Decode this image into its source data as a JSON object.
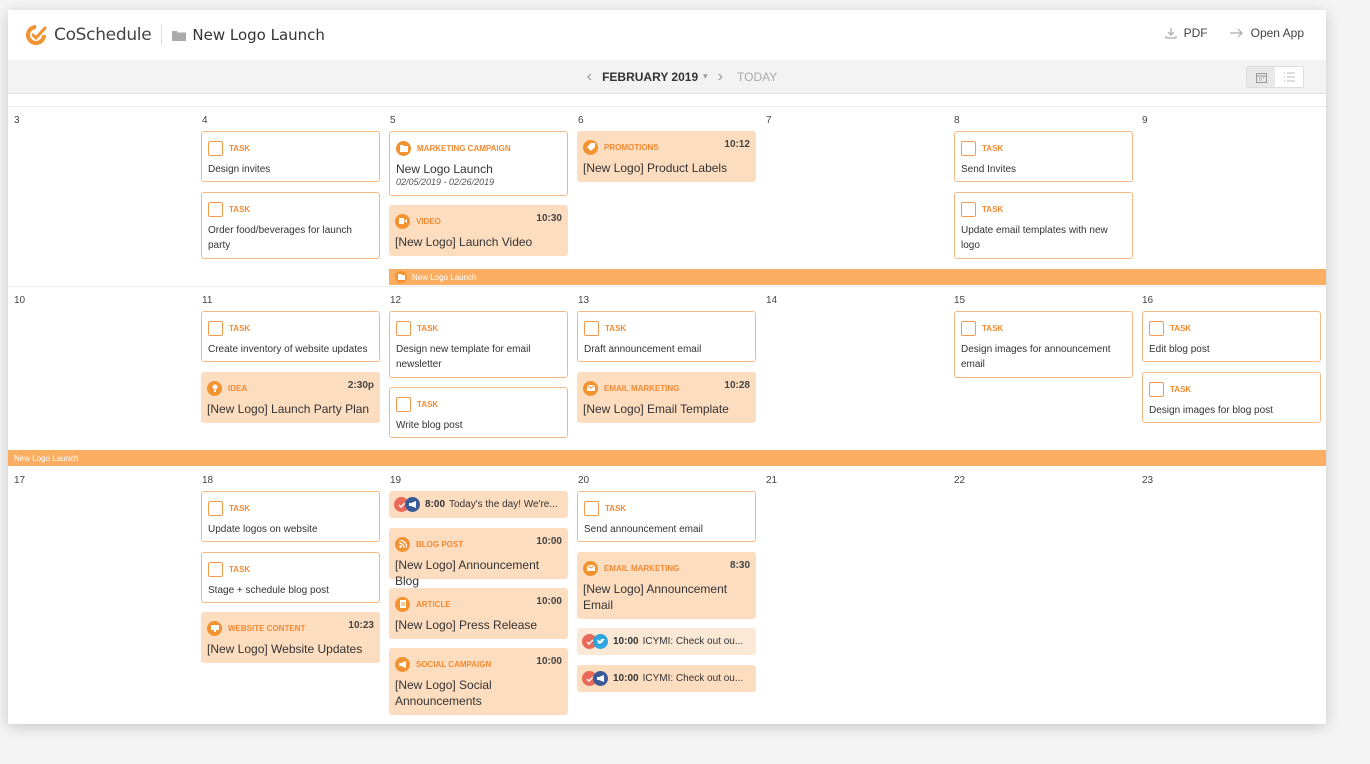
{
  "app": {
    "name": "CoSchedule",
    "brand_color": "#f39230",
    "project": "New Logo Launch"
  },
  "header": {
    "pdf_label": "PDF",
    "open_app_label": "Open App"
  },
  "nav": {
    "month": "FEBRUARY 2019",
    "today": "TODAY"
  },
  "weeks": [
    {
      "days": [
        "3",
        "4",
        "5",
        "6",
        "7",
        "8",
        "9"
      ],
      "band": "New Logo Launch",
      "items": {
        "d4_t1": {
          "type": "TASK",
          "title": "Design invites"
        },
        "d4_t2": {
          "type": "TASK",
          "title": "Order food/beverages for launch party"
        },
        "d5_c1": {
          "type": "MARKETING CAMPAIGN",
          "title": "New Logo Launch",
          "dates": "02/05/2019 - 02/26/2019"
        },
        "d5_c2": {
          "type": "VIDEO",
          "time": "10:30",
          "title": "[New Logo] Launch Video"
        },
        "d6_c1": {
          "type": "PROMOTIONS",
          "time": "10:12",
          "title": "[New Logo] Product Labels"
        },
        "d8_t1": {
          "type": "TASK",
          "title": "Send Invites"
        },
        "d8_t2": {
          "type": "TASK",
          "title": "Update email templates with new logo"
        }
      }
    },
    {
      "days": [
        "10",
        "11",
        "12",
        "13",
        "14",
        "15",
        "16"
      ],
      "band": "New Logo Launch",
      "items": {
        "d11_t1": {
          "type": "TASK",
          "title": "Create inventory of website updates"
        },
        "d11_c1": {
          "type": "IDEA",
          "time": "2:30p",
          "title": "[New Logo] Launch Party Plan"
        },
        "d12_t1": {
          "type": "TASK",
          "title": "Design new template for email newsletter"
        },
        "d12_t2": {
          "type": "TASK",
          "title": "Write blog post"
        },
        "d13_t1": {
          "type": "TASK",
          "title": "Draft announcement email"
        },
        "d13_c1": {
          "type": "EMAIL MARKETING",
          "time": "10:28",
          "title": "[New Logo] Email Template"
        },
        "d15_t1": {
          "type": "TASK",
          "title": "Design images for announcement email"
        },
        "d16_t1": {
          "type": "TASK",
          "title": "Edit blog post"
        },
        "d16_t2": {
          "type": "TASK",
          "title": "Design images for blog post"
        }
      }
    },
    {
      "days": [
        "17",
        "18",
        "19",
        "20",
        "21",
        "22",
        "23"
      ],
      "items": {
        "d18_t1": {
          "type": "TASK",
          "title": "Update logos on website"
        },
        "d18_t2": {
          "type": "TASK",
          "title": "Stage + schedule blog post"
        },
        "d18_c1": {
          "type": "WEBSITE CONTENT",
          "time": "10:23",
          "title": "[New Logo] Website Updates"
        },
        "d19_s1": {
          "time": "8:00",
          "text": "Today's the day! We're..."
        },
        "d19_c1": {
          "type": "BLOG POST",
          "time": "10:00",
          "title": "[New Logo] Announcement Blog"
        },
        "d19_c2": {
          "type": "ARTICLE",
          "time": "10:00",
          "title": "[New Logo] Press Release"
        },
        "d19_c3": {
          "type": "SOCIAL CAMPAIGN",
          "time": "10:00",
          "title": "[New Logo] Social Announcements"
        },
        "d20_t1": {
          "type": "TASK",
          "title": "Send announcement email"
        },
        "d20_c1": {
          "type": "EMAIL MARKETING",
          "time": "8:30",
          "title": "[New Logo] Announcement Email"
        },
        "d20_s1": {
          "time": "10:00",
          "text": "ICYMI: Check out ou..."
        },
        "d20_s2": {
          "time": "10:00",
          "text": "ICYMI: Check out ou..."
        }
      }
    }
  ]
}
